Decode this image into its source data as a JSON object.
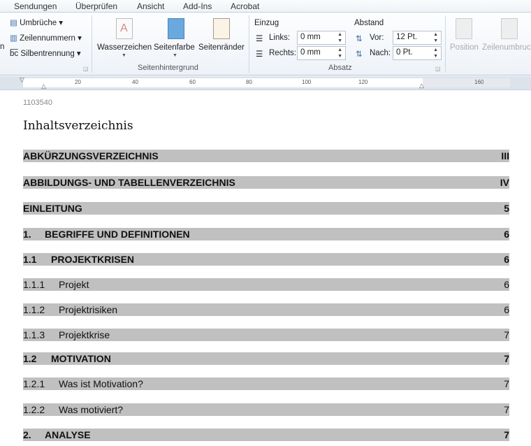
{
  "tabs": [
    "Sendungen",
    "Überprüfen",
    "Ansicht",
    "Add-Ins",
    "Acrobat"
  ],
  "ribbon": {
    "cut_label": "n",
    "umbrueche": "Umbrüche ▾",
    "zeilennummern": "Zeilennummern ▾",
    "silbentrennung": "Silbentrennung ▾",
    "wasserzeichen": "Wasserzeichen",
    "seitenfarbe": "Seitenfarbe",
    "seitenraender": "Seitenränder",
    "group_seitenhintergrund": "Seitenhintergrund",
    "einzug": "Einzug",
    "links_label": "Links:",
    "links_value": "0 mm",
    "rechts_label": "Rechts:",
    "rechts_value": "0 mm",
    "abstand": "Abstand",
    "vor_label": "Vor:",
    "vor_value": "12 Pt.",
    "nach_label": "Nach:",
    "nach_value": "0 Pt.",
    "group_absatz": "Absatz",
    "position": "Position",
    "zeilenumbruch": "Zeilenumbruc"
  },
  "ruler": [
    "20",
    "40",
    "60",
    "80",
    "100",
    "120",
    "160"
  ],
  "doc": {
    "id": "1103540",
    "heading": "Inhaltsverzeichnis",
    "entries": [
      {
        "num": "",
        "title": "ABKÜRZUNGSVERZEICHNIS",
        "page": "III",
        "bold": true
      },
      {
        "num": "",
        "title": "ABBILDUNGS- UND TABELLENVERZEICHNIS",
        "page": "IV",
        "bold": true
      },
      {
        "num": "",
        "title": "EINLEITUNG",
        "page": "5",
        "bold": true
      },
      {
        "num": "1.",
        "title": "BEGRIFFE UND DEFINITIONEN",
        "page": "6",
        "bold": true
      },
      {
        "num": "1.1",
        "title": "PROJEKTKRISEN",
        "page": "6",
        "bold": true
      },
      {
        "num": "1.1.1",
        "title": "Projekt",
        "page": "6",
        "bold": false
      },
      {
        "num": "1.1.2",
        "title": "Projektrisiken",
        "page": "6",
        "bold": false
      },
      {
        "num": "1.1.3",
        "title": "Projektkrise",
        "page": "7",
        "bold": false
      },
      {
        "num": "1.2",
        "title": "MOTIVATION",
        "page": "7",
        "bold": true
      },
      {
        "num": "1.2.1",
        "title": "Was ist Motivation?",
        "page": "7",
        "bold": false
      },
      {
        "num": "1.2.2",
        "title": "Was motiviert?",
        "page": "7",
        "bold": false
      },
      {
        "num": "2.",
        "title": "ANALYSE",
        "page": "7",
        "bold": true
      }
    ]
  }
}
